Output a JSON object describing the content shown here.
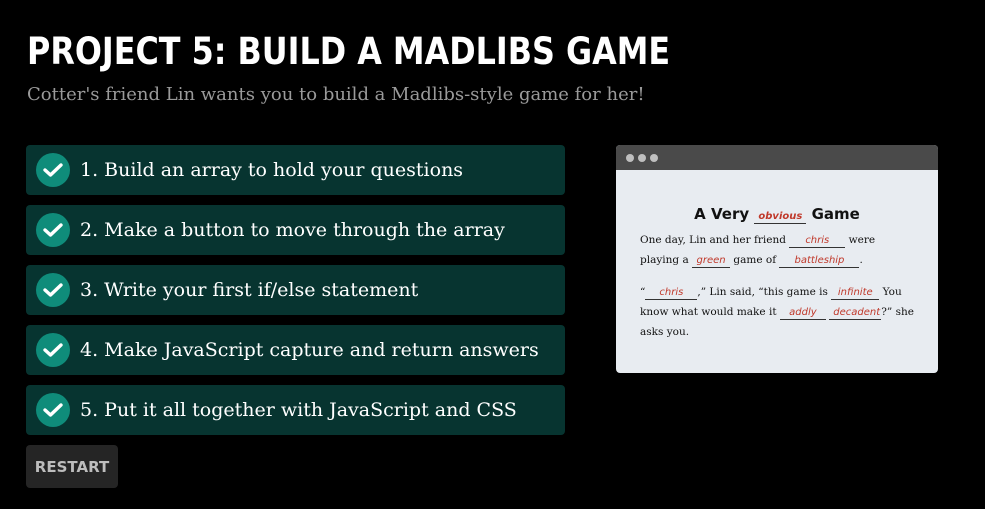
{
  "header": {
    "title": "PROJECT 5: BUILD A MADLIBS GAME",
    "subtitle": "Cotter's friend Lin wants you to build a Madlibs-style game for her!"
  },
  "steps": [
    {
      "label": "1. Build an array to hold your questions",
      "icon": "check-circle-icon"
    },
    {
      "label": "2. Make a button to move through the array",
      "icon": "check-circle-icon"
    },
    {
      "label": "3. Write your first if/else statement",
      "icon": "check-circle-icon"
    },
    {
      "label": "4. Make JavaScript capture and return answers",
      "icon": "check-circle-icon"
    },
    {
      "label": "5. Put it all together with JavaScript and CSS",
      "icon": "check-circle-icon"
    }
  ],
  "restart_label": "RESTART",
  "preview": {
    "title_pre": "A Very",
    "title_blank": "obvious",
    "title_post": "Game",
    "p1": {
      "a": "One day, Lin and her friend",
      "blank1": "chris",
      "b": "were playing a",
      "blank2": "green",
      "c": "game of",
      "blank3": "battleship",
      "d": "."
    },
    "p2": {
      "a": "“",
      "blank1": "chris",
      "b": ",” Lin said, “this game is",
      "blank2": "infinite",
      "c": "You know what would make it",
      "blank3": "addly",
      "blank4": "decadent",
      "d": "?” she asks you."
    }
  },
  "colors": {
    "background": "#000000",
    "step_bg": "#073430",
    "check_bg": "#0f8c7a",
    "restart_bg": "#252525",
    "blank_text": "#c0392b"
  }
}
